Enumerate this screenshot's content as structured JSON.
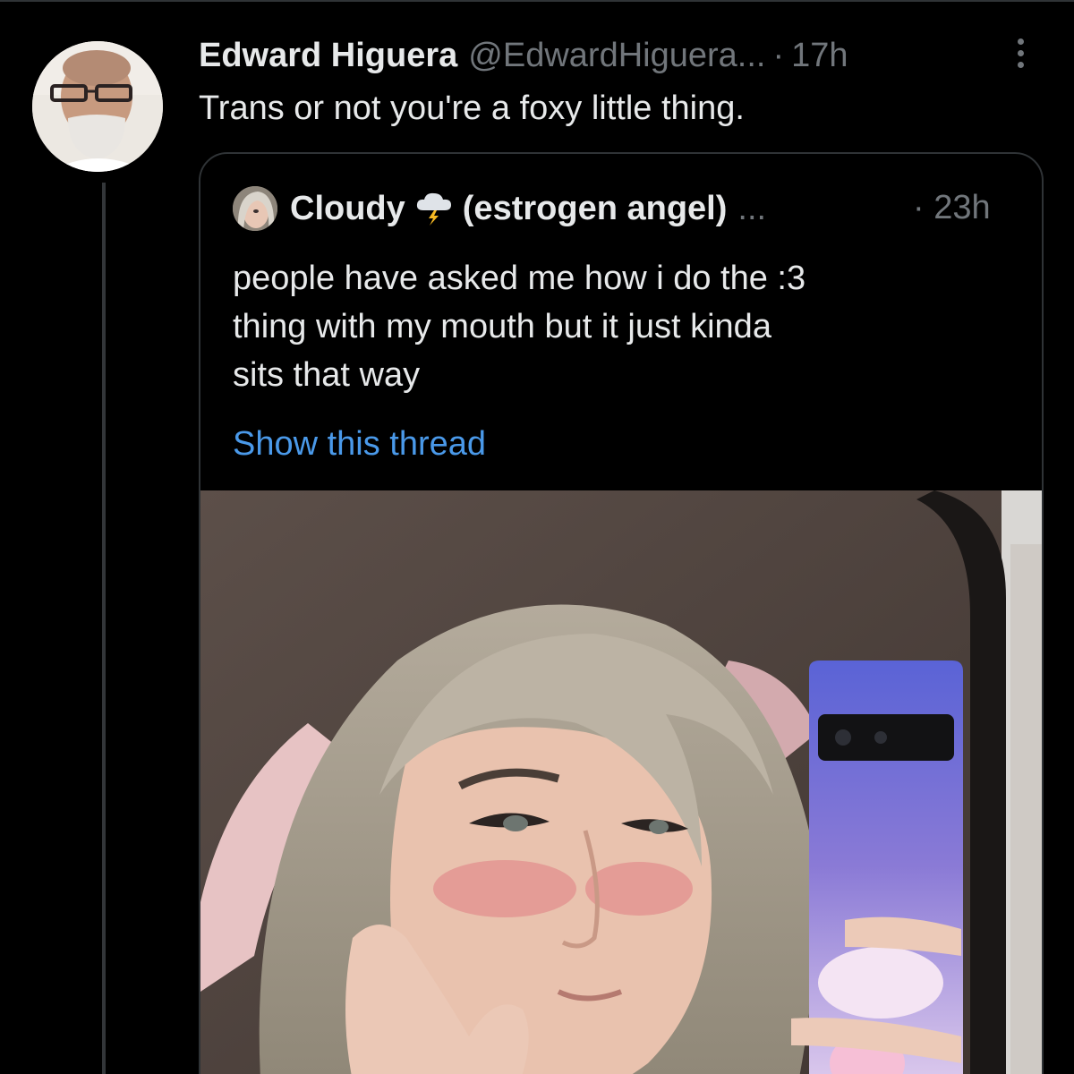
{
  "tweet": {
    "author_name": "Edward Higuera",
    "author_handle": "@EdwardHiguera...",
    "separator": "·",
    "time": "17h",
    "text": "Trans or not you're a foxy little thing."
  },
  "quoted_tweet": {
    "author_name": "Cloudy",
    "author_suffix": "(estrogen angel)",
    "ellipsis": "...",
    "separator": "·",
    "time": "23h",
    "text_lines": [
      "people have asked me how i do the :3",
      "thing with my mouth but it just kinda",
      "sits that way"
    ],
    "show_thread_label": "Show this thread"
  },
  "icons": {
    "more": "more-options-icon",
    "cloud": "cloud-lightning-emoji"
  },
  "colors": {
    "background": "#000000",
    "primary_text": "#e7e9ea",
    "secondary_text": "#71767b",
    "link": "#4a99e9",
    "border": "#2f3336"
  }
}
